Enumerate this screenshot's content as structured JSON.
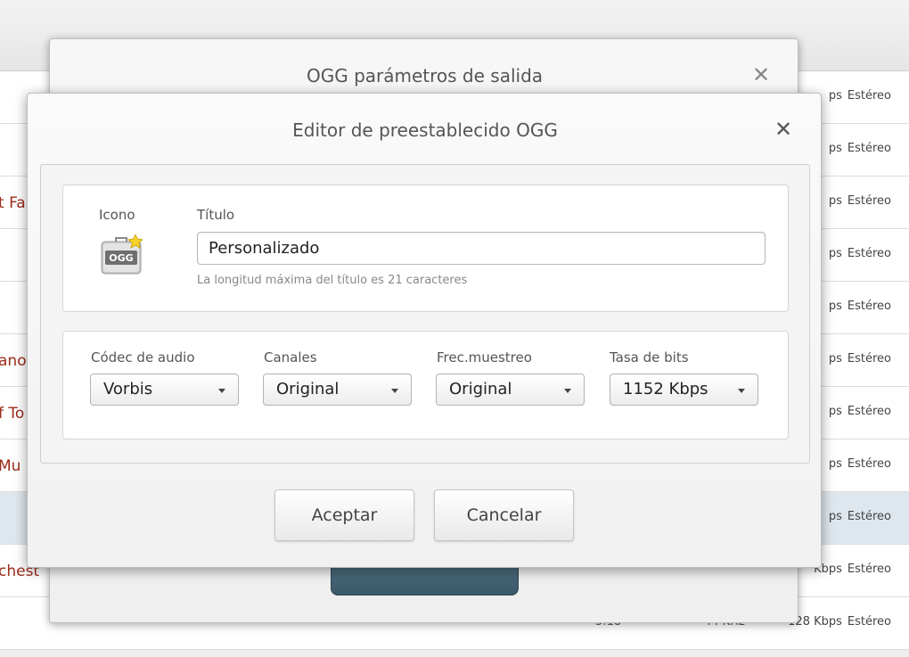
{
  "background": {
    "rows": [
      {
        "title": "",
        "channels": "Estéreo",
        "bitrate": "ps"
      },
      {
        "title": "",
        "channels": "Estéreo",
        "bitrate": "ps"
      },
      {
        "title": "t Fa",
        "channels": "Estéreo",
        "bitrate": "ps"
      },
      {
        "title": "",
        "channels": "Estéreo",
        "bitrate": "ps"
      },
      {
        "title": "",
        "channels": "Estéreo",
        "bitrate": "ps"
      },
      {
        "title": "ano",
        "channels": "Estéreo",
        "bitrate": "ps"
      },
      {
        "title": "f To",
        "channels": "Estéreo",
        "bitrate": "ps"
      },
      {
        "title": "Mu",
        "channels": "Estéreo",
        "bitrate": "ps"
      },
      {
        "title": "",
        "channels": "Estéreo",
        "bitrate": "ps"
      },
      {
        "title": "chest",
        "channels": "Estéreo",
        "bitrate": "Kbps"
      },
      {
        "title": "",
        "channels": "Estéreo",
        "bitrate": "128 Kbps",
        "duration": "5:18",
        "frequency": "44 KHz"
      }
    ]
  },
  "back_dialog": {
    "title": "OGG parámetros de salida",
    "close_glyph": "✕"
  },
  "front_dialog": {
    "title": "Editor de preestablecido OGG",
    "close_glyph": "✕",
    "icon_label": "Icono",
    "title_label": "Título",
    "title_value": "Personalizado",
    "title_hint": "La longitud máxima del título es 21 caracteres",
    "icon_text": "OGG",
    "settings": [
      {
        "label": "Códec de audio",
        "value": "Vorbis"
      },
      {
        "label": "Canales",
        "value": "Original"
      },
      {
        "label": "Frec.muestreo",
        "value": "Original"
      },
      {
        "label": "Tasa de bits",
        "value": "1152 Kbps"
      }
    ],
    "accept_label": "Aceptar",
    "cancel_label": "Cancelar"
  },
  "colors": {
    "track_title": "#9b2b1a",
    "selected_row": "#dfe7ee",
    "convert_button": "#3f5f70"
  }
}
